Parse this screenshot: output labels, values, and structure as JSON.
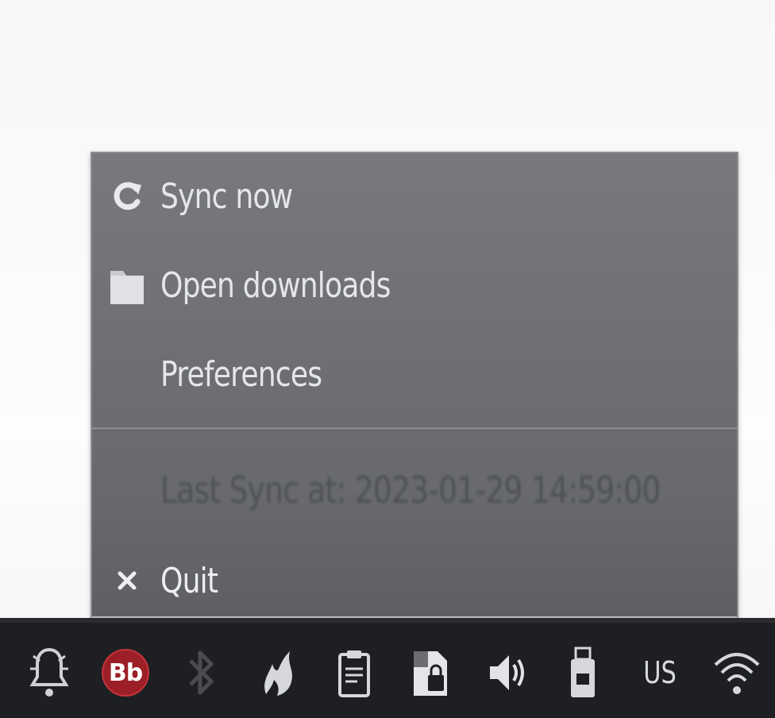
{
  "menu": {
    "items": [
      {
        "id": "sync",
        "label": "Sync now",
        "icon": "refresh-icon"
      },
      {
        "id": "open",
        "label": "Open downloads",
        "icon": "folder-icon"
      },
      {
        "id": "prefs",
        "label": "Preferences",
        "icon": ""
      },
      {
        "id": "lastsync",
        "label": "Last Sync at: 2023-01-29 14:59:00",
        "icon": "",
        "disabled": true
      },
      {
        "id": "quit",
        "label": "Quit",
        "icon": "close-icon"
      }
    ]
  },
  "taskbar": {
    "icons": [
      {
        "name": "notification-bell-icon"
      },
      {
        "name": "bb-app-icon",
        "label": "Bb"
      },
      {
        "name": "bluetooth-icon"
      },
      {
        "name": "flame-app-icon"
      },
      {
        "name": "clipboard-icon"
      },
      {
        "name": "keyring-lock-icon"
      },
      {
        "name": "volume-icon"
      },
      {
        "name": "usb-drive-icon"
      },
      {
        "name": "keyboard-layout-indicator",
        "label": "US"
      },
      {
        "name": "wifi-icon"
      }
    ]
  },
  "colors": {
    "menu_bg": "#6d6f73",
    "menu_text": "#e4e6e8",
    "taskbar_bg": "#1d1f22",
    "bb_badge": "#9c1f27"
  }
}
